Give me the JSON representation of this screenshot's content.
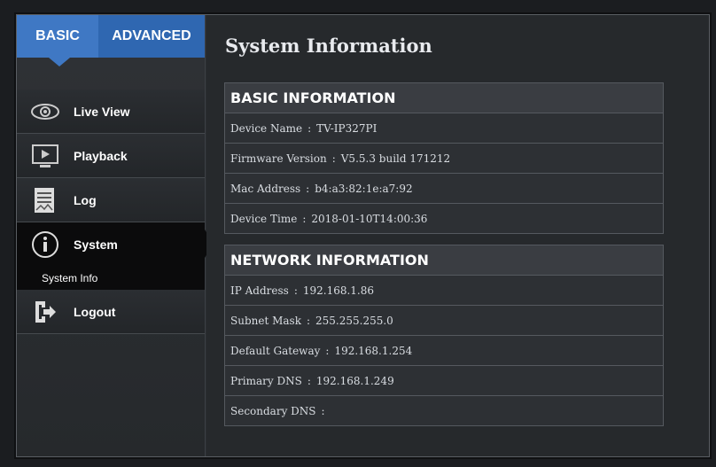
{
  "tabs": {
    "basic": "BASIC",
    "advanced": "ADVANCED"
  },
  "sidebar": {
    "items": [
      {
        "label": "Live View",
        "icon": "eye-icon"
      },
      {
        "label": "Playback",
        "icon": "playback-icon"
      },
      {
        "label": "Log",
        "icon": "log-icon"
      },
      {
        "label": "System",
        "icon": "info-icon"
      },
      {
        "label": "Logout",
        "icon": "logout-icon"
      }
    ],
    "sub_item": "System Info"
  },
  "page_title": "System Information",
  "basic": {
    "title": "BASIC INFORMATION",
    "rows": [
      {
        "label": "Device Name",
        "value": "TV-IP327PI"
      },
      {
        "label": "Firmware Version",
        "value": "V5.5.3 build 171212"
      },
      {
        "label": "Mac Address",
        "value": "b4:a3:82:1e:a7:92"
      },
      {
        "label": "Device Time",
        "value": "2018-01-10T14:00:36"
      }
    ]
  },
  "network": {
    "title": "NETWORK INFORMATION",
    "rows": [
      {
        "label": "IP Address",
        "value": "192.168.1.86"
      },
      {
        "label": "Subnet Mask",
        "value": "255.255.255.0"
      },
      {
        "label": "Default Gateway",
        "value": "192.168.1.254"
      },
      {
        "label": "Primary DNS",
        "value": "192.168.1.249"
      },
      {
        "label": "Secondary DNS",
        "value": ""
      }
    ]
  },
  "colors": {
    "accent": "#3f78c4",
    "active_bg": "#0b0b0c"
  }
}
